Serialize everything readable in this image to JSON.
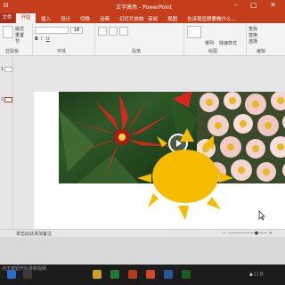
{
  "window": {
    "title": "文字高亮 - PowerPoint",
    "quick_access": "⊟",
    "controls": "– □ ✕"
  },
  "ribbon_tabs": {
    "file": "文件",
    "home": "开始",
    "insert": "插入",
    "design": "设计",
    "transitions": "切换",
    "animations": "动画",
    "slideshow": "幻灯片放映",
    "review": "审阅",
    "view": "视图",
    "tell_me": "告诉我您想要做什么..."
  },
  "ribbon_groups": {
    "clipboard": "剪贴板",
    "font": "字体",
    "paragraph": "段落",
    "drawing": "绘图",
    "editing": "编辑"
  },
  "ribbon_items": {
    "layout": "版式",
    "reset": "重置",
    "section": "节",
    "font_size": "18",
    "find": "查找",
    "replace": "替换",
    "select": "选择",
    "arrange": "排列",
    "quick_styles": "快速样式"
  },
  "thumbnails": [
    "1",
    "2"
  ],
  "status": {
    "left": "单击此处添加备注",
    "zoom": "− ——————●—— +"
  },
  "taskbar": {
    "left_text": "点击按钮开始录制视频",
    "clock": "▲ □ ))"
  },
  "colors": {
    "accent": "#c43e1c",
    "sun": "#f5bc00",
    "flower_red": "#d8261f",
    "leaf_green": "#2f5a28",
    "daisy_pink": "#efc4c4"
  }
}
